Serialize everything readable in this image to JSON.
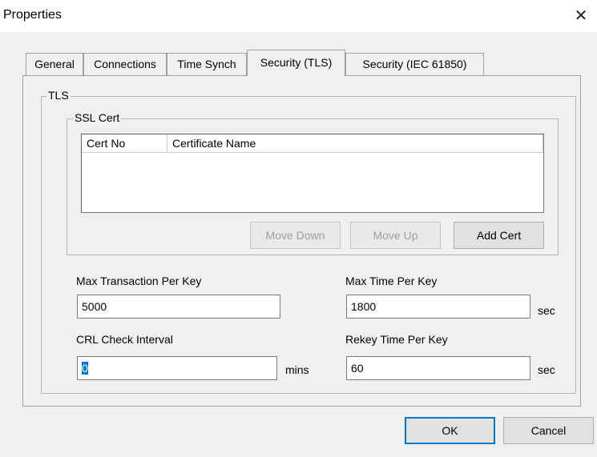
{
  "window": {
    "title": "Properties",
    "close_glyph": "✕"
  },
  "tabs": [
    {
      "label": "General"
    },
    {
      "label": "Connections"
    },
    {
      "label": "Time Synch"
    },
    {
      "label": "Security (TLS)"
    },
    {
      "label": "Security (IEC 61850)"
    }
  ],
  "tls": {
    "group_label": "TLS",
    "ssl_cert": {
      "group_label": "SSL Cert",
      "columns": [
        "Cert No",
        "Certificate Name"
      ],
      "buttons": {
        "move_down": "Move Down",
        "move_up": "Move Up",
        "add_cert": "Add Cert"
      }
    },
    "fields": {
      "max_transaction": {
        "label": "Max Transaction Per Key",
        "value": "5000"
      },
      "max_time": {
        "label": "Max Time Per Key",
        "value": "1800",
        "unit": "sec"
      },
      "crl_interval": {
        "label": "CRL Check Interval",
        "value": "0",
        "unit": "mins"
      },
      "rekey_time": {
        "label": "Rekey Time Per Key",
        "value": "60",
        "unit": "sec"
      }
    }
  },
  "footer": {
    "ok": "OK",
    "cancel": "Cancel"
  }
}
